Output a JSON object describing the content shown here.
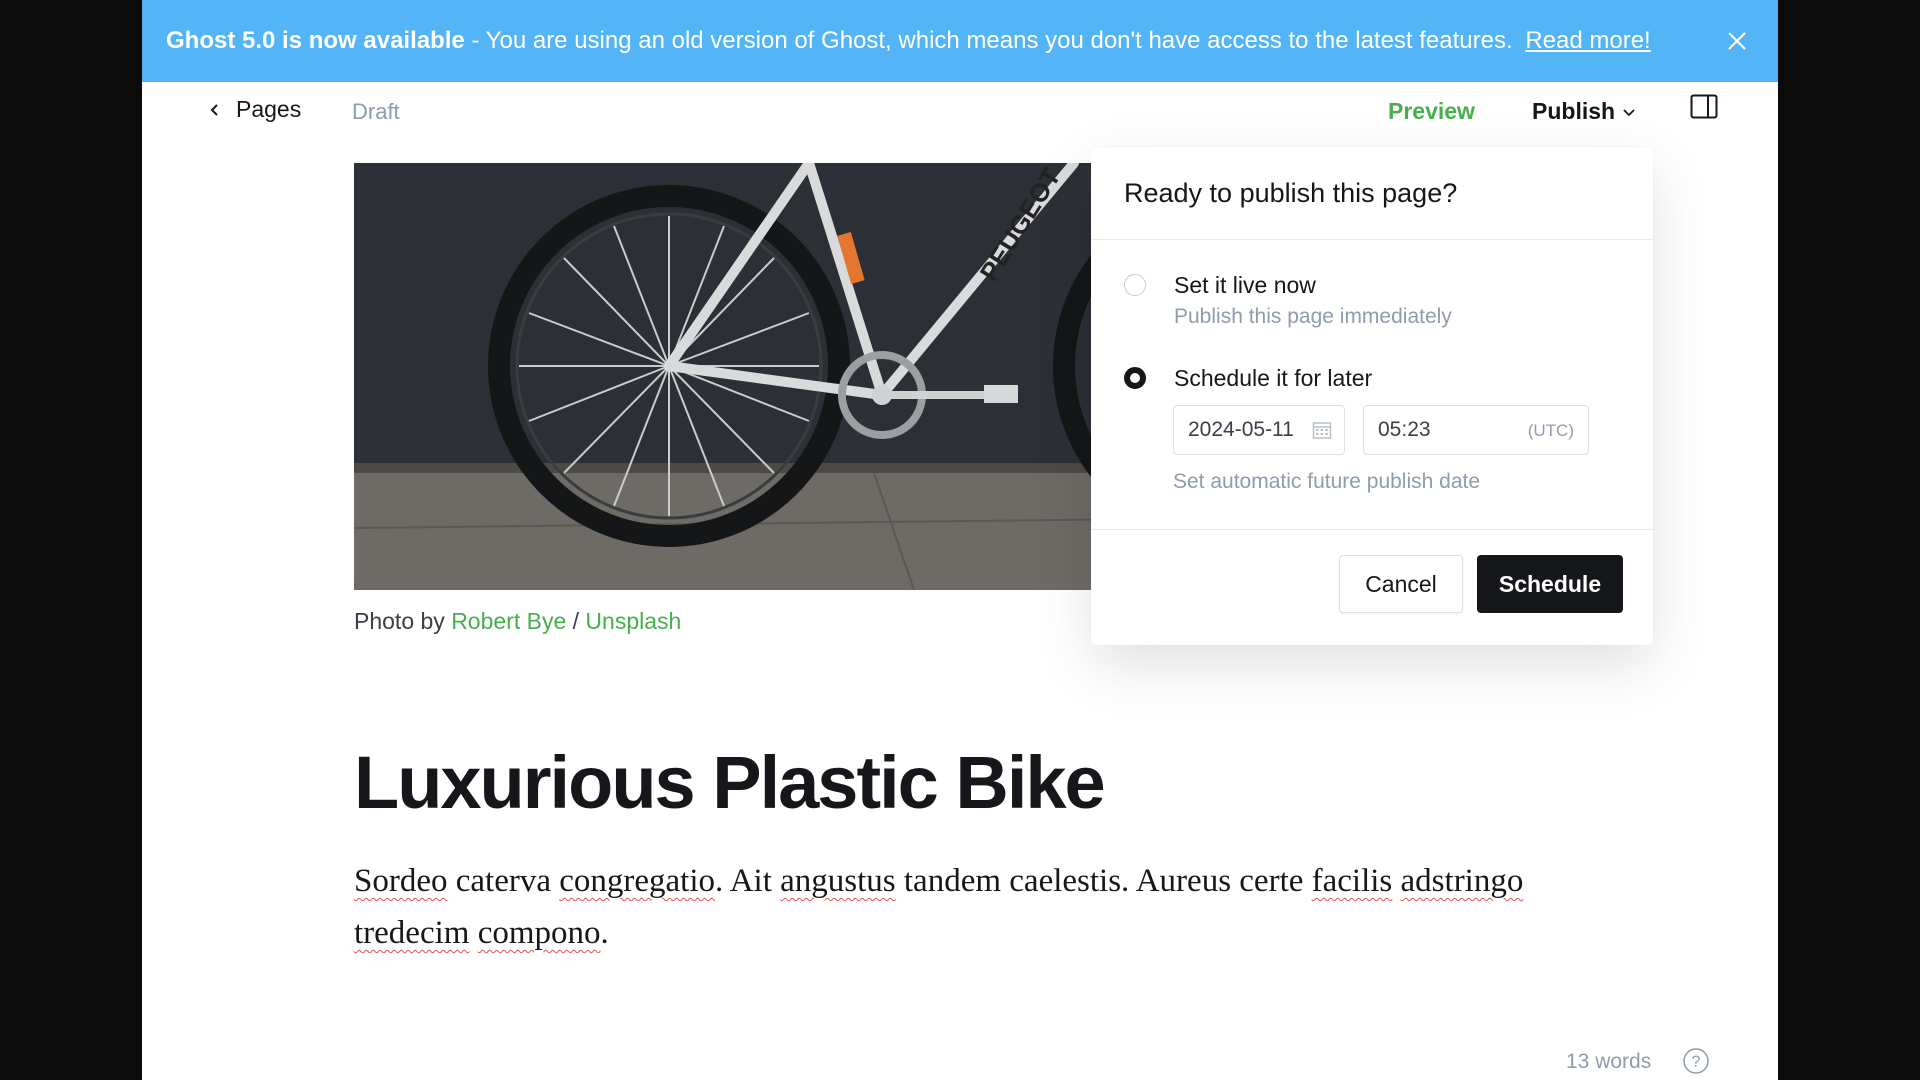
{
  "banner": {
    "headline": "Ghost 5.0 is now available",
    "message": " - You are using an old version of Ghost, which means you don't have access to the latest features. ",
    "link": "Read more!",
    "close_icon": "close-icon"
  },
  "topbar": {
    "back_label": "Pages",
    "status": "Draft",
    "preview": "Preview",
    "publish": "Publish",
    "sidebar_icon": "sidebar-toggle-icon"
  },
  "feature_image": {
    "alt": "bicycle-photo",
    "caption_prefix": "Photo by ",
    "author": "Robert Bye",
    "separator": " / ",
    "source": "Unsplash"
  },
  "post": {
    "title": "Luxurious Plastic Bike",
    "body": [
      {
        "t": "Sordeo",
        "sp": true
      },
      {
        "t": " caterva ",
        "sp": false
      },
      {
        "t": "congregatio",
        "sp": true
      },
      {
        "t": ". Ait ",
        "sp": false
      },
      {
        "t": "angustus",
        "sp": true
      },
      {
        "t": " tandem caelestis. Aureus certe ",
        "sp": false
      },
      {
        "t": "facilis",
        "sp": true
      },
      {
        "t": " ",
        "sp": false
      },
      {
        "t": "adstringo",
        "sp": true
      },
      {
        "t": " ",
        "sp": false
      },
      {
        "t": "tredecim",
        "sp": true
      },
      {
        "t": " ",
        "sp": false
      },
      {
        "t": "compono",
        "sp": true
      },
      {
        "t": ".",
        "sp": false
      }
    ]
  },
  "footer": {
    "word_count": "13 words",
    "help_icon": "help-icon"
  },
  "publish_menu": {
    "title": "Ready to publish this page?",
    "options": [
      {
        "label": "Set it live now",
        "description": "Publish this page immediately",
        "selected": false
      },
      {
        "label": "Schedule it for later",
        "selected": true
      }
    ],
    "date_value": "2024-05-11",
    "time_value": "05:23",
    "timezone": "(UTC)",
    "hint": "Set automatic future publish date",
    "cancel": "Cancel",
    "schedule": "Schedule"
  }
}
